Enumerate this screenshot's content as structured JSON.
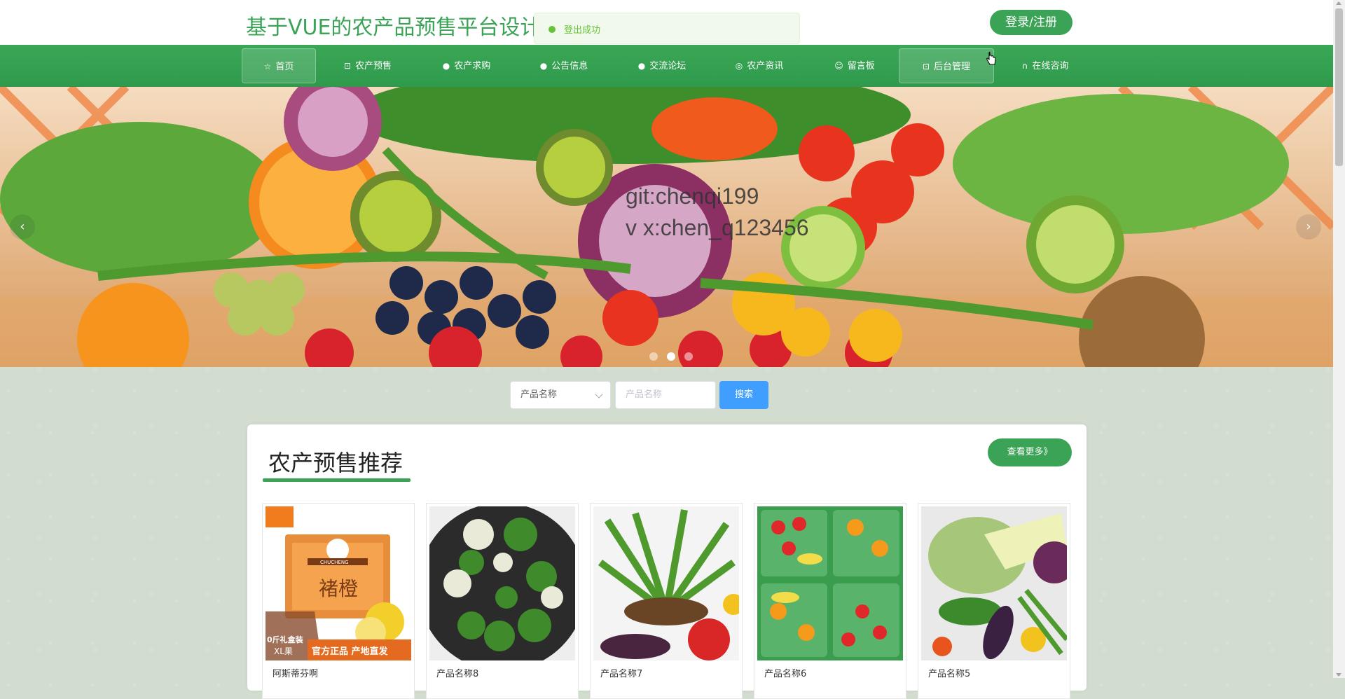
{
  "header": {
    "site_title": "基于VUE的农产品预售平台设计",
    "login_label": "登录/注册"
  },
  "toast": {
    "message": "登出成功",
    "color": "#67c23a"
  },
  "nav": {
    "items": [
      {
        "label": "首页",
        "icon": "star-icon"
      },
      {
        "label": "农产预售",
        "icon": "bag-icon"
      },
      {
        "label": "农产求购",
        "icon": "info-icon"
      },
      {
        "label": "公告信息",
        "icon": "question-icon"
      },
      {
        "label": "交流论坛",
        "icon": "info-icon"
      },
      {
        "label": "农产资讯",
        "icon": "globe-icon"
      },
      {
        "label": "留言板",
        "icon": "smile-icon"
      },
      {
        "label": "后台管理",
        "icon": "briefcase-icon"
      },
      {
        "label": "在线咨询",
        "icon": "headset-icon"
      }
    ],
    "accent_color": "#3aa356"
  },
  "banner": {
    "watermark_line1": "git:chenqi199",
    "watermark_line2": "v x:chen_q123456",
    "prev_label": "‹",
    "next_label": "›"
  },
  "search": {
    "select_value": "产品名称",
    "input_placeholder": "产品名称",
    "button_label": "搜索"
  },
  "section": {
    "title": "农产预售推荐",
    "more_label": "查看更多》",
    "products": [
      {
        "name": "阿斯蒂芬啊",
        "badge_text_1": "0斤礼盒装",
        "badge_text_2": "XL果",
        "badge_text_3": "官方正品 产地直发",
        "brand_text": "褚橙",
        "brand_en": "CHUCHENG"
      },
      {
        "name": "产品名称8"
      },
      {
        "name": "产品名称7"
      },
      {
        "name": "产品名称6"
      },
      {
        "name": "产品名称5"
      }
    ]
  }
}
